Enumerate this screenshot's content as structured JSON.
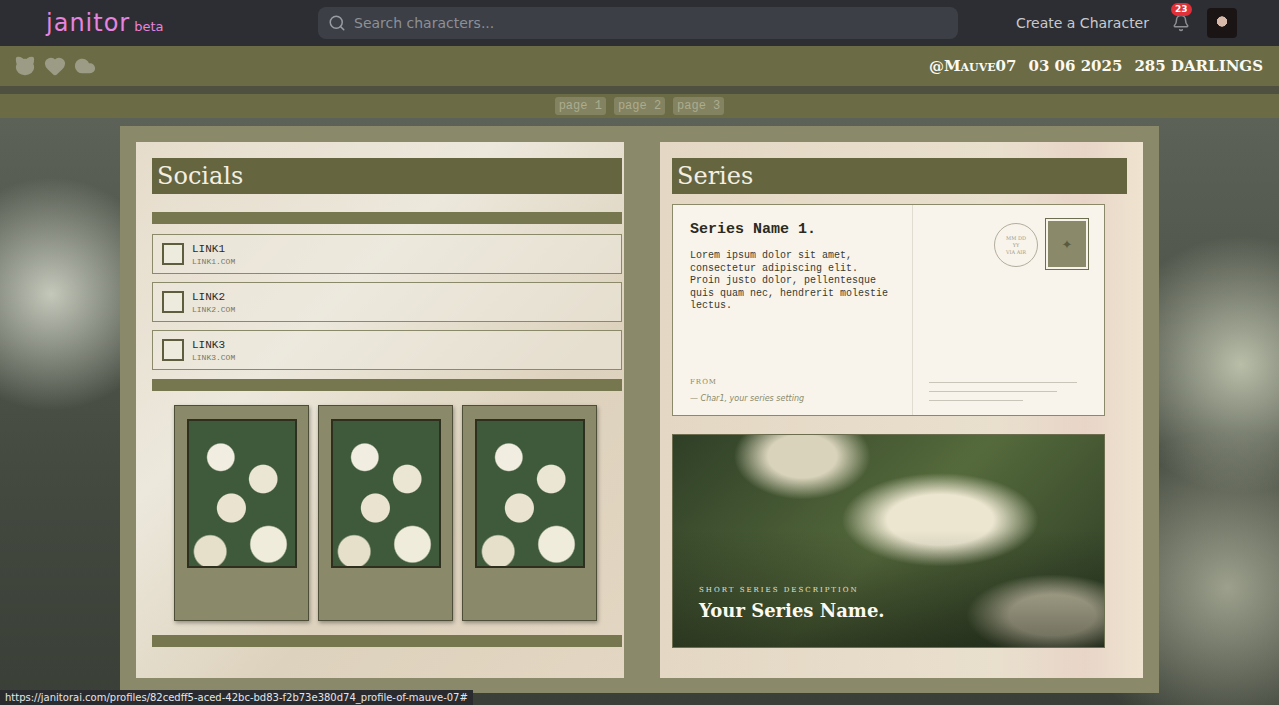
{
  "nav": {
    "logo": "janitor",
    "badge": "beta",
    "search_placeholder": "Search characters...",
    "create_button": "Create a Character",
    "notifications": "23"
  },
  "profile_bar": {
    "username": "@Mauve07",
    "date": "03 06 2025",
    "followers": "285 DARLINGS"
  },
  "pages": [
    {
      "label": "page 1",
      "selected": false
    },
    {
      "label": "page 2",
      "selected": false
    },
    {
      "label": "page 3",
      "selected": false
    }
  ],
  "socials": {
    "title": "Socials",
    "links": [
      {
        "label": "LINK1",
        "url": "LINK1.COM",
        "checked": false
      },
      {
        "label": "LINK2",
        "url": "LINK2.COM",
        "checked": false
      },
      {
        "label": "LINK3",
        "url": "LINK3.COM",
        "checked": false
      }
    ]
  },
  "series": {
    "title": "Series",
    "card": {
      "title": "Series Name 1.",
      "body": "Lorem ipsum dolor sit amet, consectetur adipiscing elit. Proin justo dolor, pellentesque quis quam nec, hendrerit molestie lectus.",
      "from_label": "FROM",
      "from": "— Char1, your series setting",
      "postmark": [
        "MM DD",
        "YY",
        "VIA AIR"
      ],
      "stamp": "✦"
    },
    "feature": {
      "description": "SHORT SERIES DESCRIPTION",
      "name": "Your Series Name."
    }
  },
  "status_bar": {
    "url": "https://janitorai.com/profiles/82cedff5-aced-42bc-bd83-f2b73e380d74_profile-of-mauve-07#"
  }
}
